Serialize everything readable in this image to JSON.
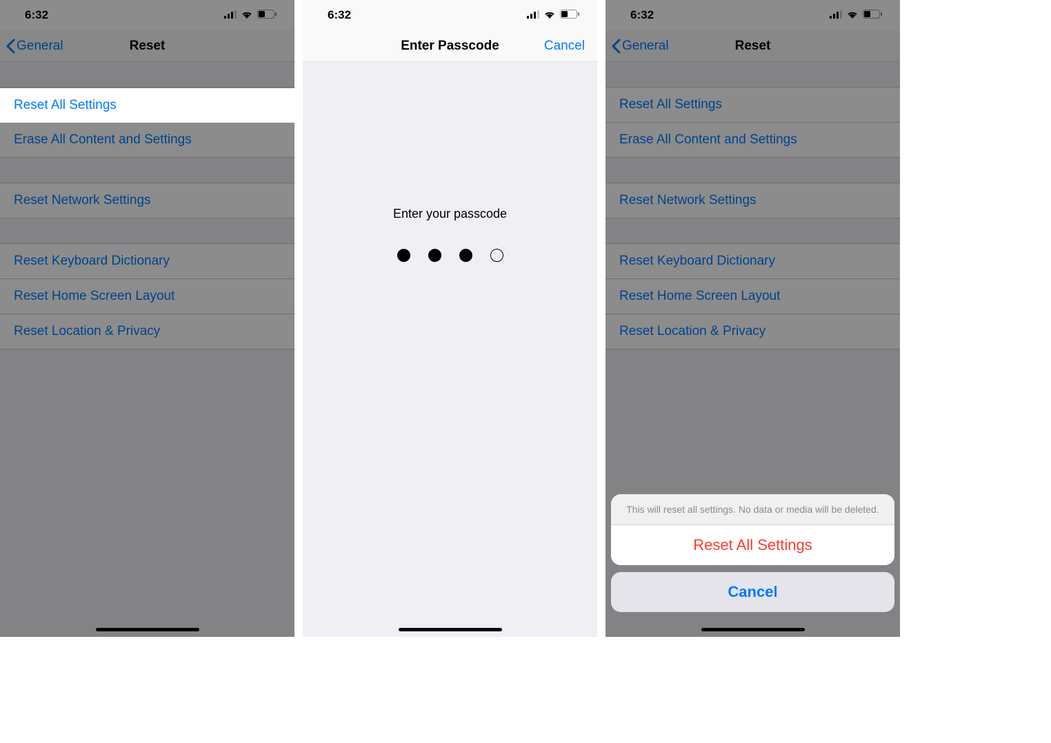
{
  "statusbar": {
    "time": "6:32"
  },
  "screen1": {
    "back_label": "General",
    "title": "Reset",
    "items": {
      "reset_all": "Reset All Settings",
      "erase_all": "Erase All Content and Settings",
      "reset_network": "Reset Network Settings",
      "reset_keyboard": "Reset Keyboard Dictionary",
      "reset_home": "Reset Home Screen Layout",
      "reset_location": "Reset Location & Privacy"
    }
  },
  "screen2": {
    "title": "Enter Passcode",
    "cancel": "Cancel",
    "prompt": "Enter your passcode",
    "dots_filled": 3,
    "dots_total": 4
  },
  "screen3": {
    "back_label": "General",
    "title": "Reset",
    "sheet": {
      "message": "This will reset all settings. No data or media will be deleted.",
      "confirm": "Reset All Settings",
      "cancel": "Cancel"
    }
  }
}
